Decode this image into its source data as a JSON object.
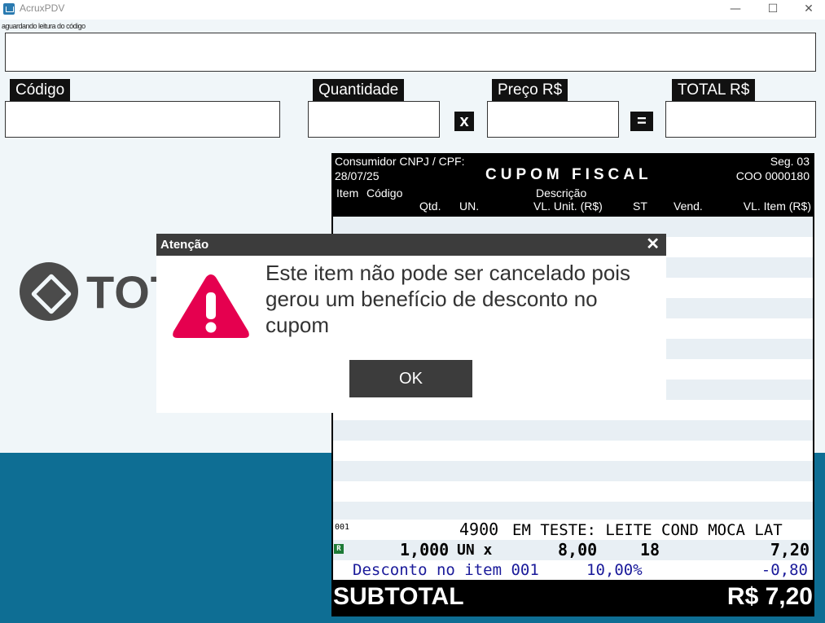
{
  "window": {
    "title": "AcruxPDV",
    "minimize_glyph": "—",
    "maximize_glyph": "☐",
    "close_glyph": "✕"
  },
  "status_text": "aguardando leitura do código",
  "fields": {
    "codigo_label": "Código",
    "quantidade_label": "Quantidade",
    "preco_label": "Preço R$",
    "total_label": "TOTAL R$",
    "multiply_sign": "x",
    "equals_sign": "="
  },
  "brand": {
    "name": "TOT"
  },
  "coupon": {
    "consumer_label": "Consumidor CNPJ / CPF:",
    "date": "28/07/25",
    "title": "CUPOM FISCAL",
    "seq": "Seg. 03",
    "coo": "COO 0000180",
    "columns": {
      "item": "Item",
      "codigo": "Código",
      "descricao": "Descrição",
      "qtd": "Qtd.",
      "un": "UN.",
      "vl_unit": "VL. Unit. (R$)",
      "st": "ST",
      "vend": "Vend.",
      "vl_item": "VL. Item (R$)"
    },
    "item": {
      "number": "001",
      "code": "4900",
      "description": "EM TESTE: LEITE COND MOCA LAT",
      "badge": "R",
      "qty": "1,000",
      "unit": "UN x",
      "unit_price": "8,00",
      "st": "18",
      "total": "7,20",
      "discount_label": "Desconto no item 001",
      "discount_pct": "10,00%",
      "discount_value": "-0,80"
    },
    "subtotal_label": "SUBTOTAL",
    "subtotal_value": "R$ 7,20"
  },
  "dialog": {
    "title": "Atenção",
    "close_glyph": "✕",
    "message": "Este item não pode ser cancelado pois gerou um benefício de desconto no cupom",
    "ok_label": "OK"
  },
  "colors": {
    "background": "#f0f6f9",
    "band": "#0e6e94",
    "warning": "#e5004f",
    "dialog_title": "#3c3c3c",
    "discount_text": "#1a1a9a"
  }
}
